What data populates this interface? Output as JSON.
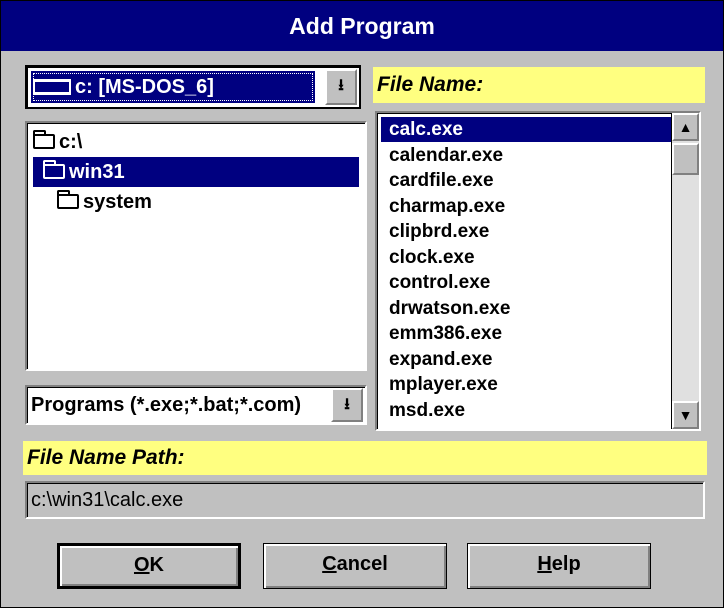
{
  "window": {
    "title": "Add Program"
  },
  "drive": {
    "selected": "c: [MS-DOS_6]",
    "button_glyph": "⭳"
  },
  "directories": [
    {
      "label": "c:\\",
      "icon": "folder-open-icon",
      "selected": false
    },
    {
      "label": "win31",
      "icon": "folder-open-icon",
      "selected": true
    },
    {
      "label": "system",
      "icon": "folder-closed-icon",
      "selected": false
    }
  ],
  "filter": {
    "selected": "Programs (*.exe;*.bat;*.com)",
    "button_glyph": "⭳"
  },
  "file_name": {
    "label": "File Name:",
    "files": [
      "calc.exe",
      "calendar.exe",
      "cardfile.exe",
      "charmap.exe",
      "clipbrd.exe",
      "clock.exe",
      "control.exe",
      "drwatson.exe",
      "emm386.exe",
      "expand.exe",
      "mplayer.exe",
      "msd.exe"
    ],
    "selected_index": 0,
    "scroll_up": "▲",
    "scroll_down": "▼"
  },
  "path": {
    "label": "File Name Path:",
    "value": "c:\\win31\\calc.exe"
  },
  "buttons": {
    "ok": "OK",
    "cancel": "Cancel",
    "help": "Help",
    "ok_mnemonic": "O",
    "cancel_mnemonic": "C",
    "help_mnemonic": "H"
  },
  "colors": {
    "titlebar": "#000080",
    "selection": "#000080",
    "label_bg": "#ffff80",
    "face": "#c0c0c0"
  }
}
